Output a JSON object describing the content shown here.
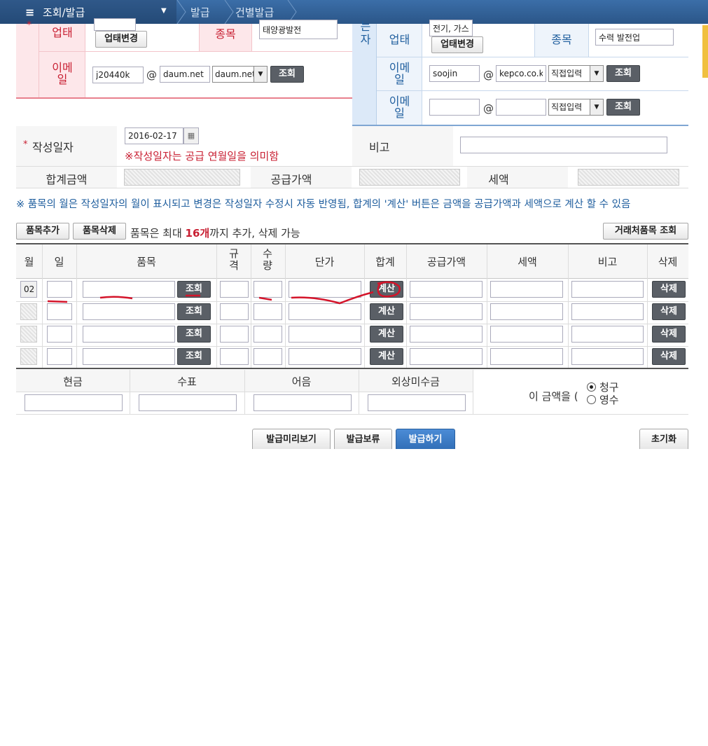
{
  "nav": {
    "menu_label": "조회/발급",
    "crumb1": "발급",
    "crumb2": "건별발급"
  },
  "supplier": {
    "business_type_label": "업태",
    "item_label": "종목",
    "item_value": "태양광발전",
    "business_change_button": "업태변경",
    "email_label": "이메일",
    "email_id": "j20440k",
    "email_domain": "daum.net",
    "email_domain_select": "daum.net",
    "lookup_button": "조회"
  },
  "receiver": {
    "side_label": "받는자",
    "business_type_label": "업태",
    "business_type_value": "전기, 가스",
    "business_change_button": "업태변경",
    "item_label": "종목",
    "item_value": "수력 발전업",
    "email_label": "이메일",
    "email1_id": "soojin",
    "email1_domain": "kepco.co.k",
    "email1_select": "직접입력",
    "email2_id": "",
    "email2_domain": "",
    "email2_select": "직접입력",
    "lookup_button": "조회"
  },
  "at_sign": "@",
  "write_date": {
    "required_mark": "*",
    "label": "작성일자",
    "value": "2016-02-17",
    "note": "※작성일자는 공급 연월일을 의미함"
  },
  "remarks_label": "비고",
  "totals": {
    "total_label": "합계금액",
    "supply_label": "공급가액",
    "tax_label": "세액"
  },
  "info_note": "※ 품목의 월은 작성일자의 월이 표시되고 변경은 작성일자 수정시 자동 반영됨, 합계의 '계산' 버튼은 금액을 공급가액과 세액으로 계산 할 수 있음",
  "item_controls": {
    "add_button": "품목추가",
    "delete_button": "품목삭제",
    "limit_prefix": "품목은 최대 ",
    "limit_count": "16개",
    "limit_suffix": "까지 추가, 삭제 가능",
    "partner_lookup_button": "거래처품목 조회"
  },
  "table": {
    "headers": [
      "월",
      "일",
      "품목",
      "규격",
      "수량",
      "단가",
      "합계",
      "공급가액",
      "세액",
      "비고",
      "삭제"
    ],
    "first_month": "02",
    "lookup_button": "조회",
    "calc_button": "계산",
    "delete_button": "삭제"
  },
  "payment": {
    "cash": "현금",
    "check": "수표",
    "note": "어음",
    "credit": "외상미수금",
    "amount_prefix": "이 금액을 (",
    "claim": "청구",
    "receipt": "영수",
    "selected": "청구"
  },
  "actions": {
    "preview": "발급미리보기",
    "hold": "발급보류",
    "issue": "발급하기",
    "reset": "초기화"
  },
  "colors": {
    "nav_bg": "#2f5d92",
    "supplier_bg": "#fde7ea",
    "receiver_bg": "#dce9f8",
    "accent_red": "#c81f32",
    "issue_blue": "#3a7bc8"
  }
}
